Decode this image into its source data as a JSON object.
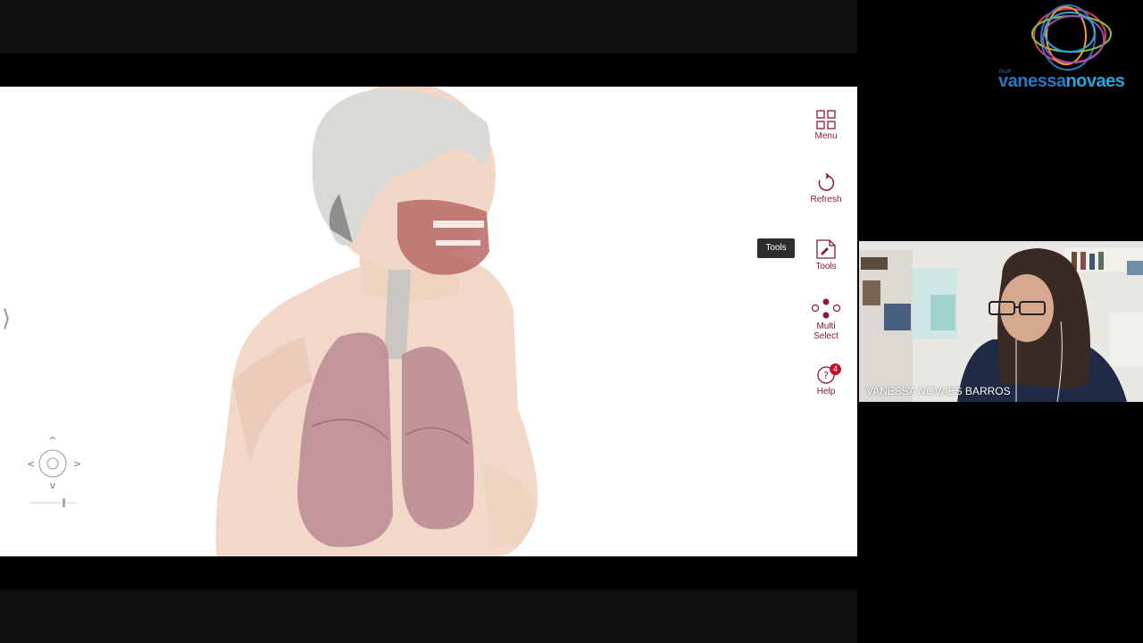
{
  "toolbar": {
    "menu_label": "Menu",
    "refresh_label": "Refresh",
    "tools_label": "Tools",
    "multi_select_label_1": "Multi",
    "multi_select_label_2": "Select",
    "help_label": "Help",
    "help_badge": "4",
    "tooltip": "Tools"
  },
  "branding": {
    "prefix": "Profª",
    "name_part1": "vanessa",
    "name_part2": "novaes"
  },
  "webcam": {
    "participant_name": "VANESSA NOVAES BARROS"
  },
  "colors": {
    "accent": "#8b1a36",
    "badge": "#c8102e",
    "logo_blue": "#2a78c2"
  }
}
